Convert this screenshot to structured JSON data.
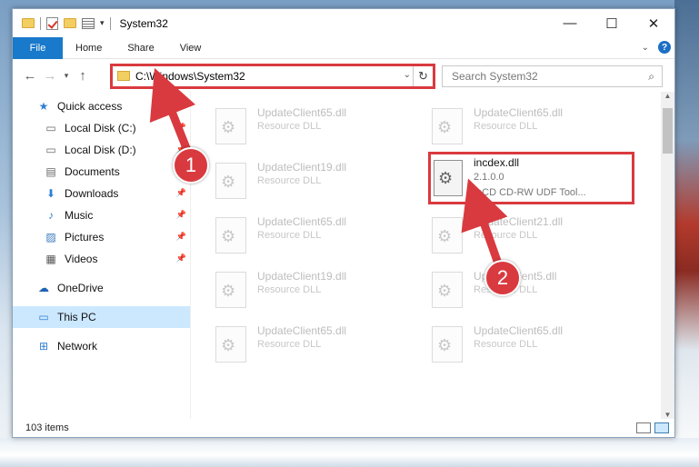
{
  "window": {
    "title": "System32",
    "controls": {
      "minimize": "—",
      "maximize": "☐",
      "close": "✕"
    }
  },
  "ribbon": {
    "tabs": [
      {
        "label": "File"
      },
      {
        "label": "Home"
      },
      {
        "label": "Share"
      },
      {
        "label": "View"
      }
    ],
    "expand_icon": "chevron-down-icon",
    "help_label": "?"
  },
  "address": {
    "path": "C:\\Windows\\System32",
    "search_placeholder": "Search System32"
  },
  "nav": {
    "items": [
      {
        "label": "Quick access",
        "icon": "star-icon"
      },
      {
        "label": "Local Disk (C:)",
        "icon": "drive-icon"
      },
      {
        "label": "Local Disk (D:)",
        "icon": "drive-icon"
      },
      {
        "label": "Documents",
        "icon": "documents-icon"
      },
      {
        "label": "Downloads",
        "icon": "download-icon"
      },
      {
        "label": "Music",
        "icon": "music-icon"
      },
      {
        "label": "Pictures",
        "icon": "pictures-icon"
      },
      {
        "label": "Videos",
        "icon": "videos-icon"
      },
      {
        "label": "OneDrive",
        "icon": "cloud-icon"
      },
      {
        "label": "This PC",
        "icon": "computer-icon"
      },
      {
        "label": "Network",
        "icon": "network-icon"
      }
    ]
  },
  "files": [
    {
      "name": "UpdateClient65.dll",
      "desc": "Resource DLL"
    },
    {
      "name": "UpdateClient65.dll",
      "desc": "Resource DLL"
    },
    {
      "name": "UpdateClient19.dll",
      "desc": "Resource DLL"
    },
    {
      "name": "UpdateClient65.dll",
      "desc": "Resource DLL"
    },
    {
      "name": "UpdateClient21.dll",
      "desc": "Resource DLL"
    },
    {
      "name": "UpdateClient19.dll",
      "desc": "Resource DLL"
    },
    {
      "name": "UpdateClient5.dll",
      "desc": "Resource DLL"
    },
    {
      "name": "UpdateClient65.dll",
      "desc": "Resource DLL"
    },
    {
      "name": "UpdateClient65.dll",
      "desc": "Resource DLL"
    }
  ],
  "highlighted_file": {
    "name": "incdex.dll",
    "version": "2.1.0.0",
    "desc": "InCD CD-RW UDF Tool..."
  },
  "callouts": {
    "one": "1",
    "two": "2"
  },
  "status": {
    "items": "103 items"
  },
  "colors": {
    "accent": "#1979ca",
    "highlight": "#d93a3f",
    "selection": "#cce8ff"
  }
}
